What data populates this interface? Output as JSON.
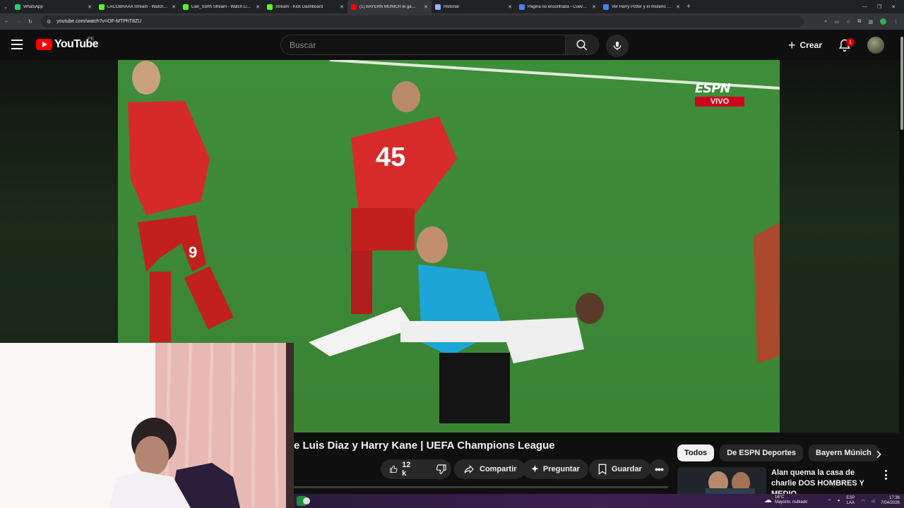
{
  "browser": {
    "tabs": [
      {
        "title": "WhatsApp",
        "color": "#25d366",
        "active": false
      },
      {
        "title": "LACOBRAAA Stream - Watch Li…",
        "color": "#53fc18",
        "active": false
      },
      {
        "title": "Lian_Sorth Stream - Watch Liv…",
        "color": "#53fc18",
        "active": false
      },
      {
        "title": "Stream - Kick Dashboard",
        "color": "#53fc18",
        "active": false
      },
      {
        "title": "(1) BAYERN MUNICH le ga…",
        "color": "#ff0000",
        "active": true
      },
      {
        "title": "Historial",
        "color": "#8ab4f8",
        "active": false
      },
      {
        "title": "Página no encontrada - Cuevan…",
        "color": "#4285f4",
        "active": false
      },
      {
        "title": "Ver Harry Potter y el misterio d…",
        "color": "#4285f4",
        "active": false
      }
    ],
    "url": "youtube.com/watch?v=OF-MTPhT8ZU"
  },
  "youtube": {
    "logo_text": "YouTube",
    "country_code": "PE",
    "search_placeholder": "Buscar",
    "create_label": "Crear",
    "notification_count": "1"
  },
  "player": {
    "broadcaster": "ESPN",
    "live_label": "VIVO"
  },
  "video": {
    "title": "e Luis Diaz y Harry Kane | UEFA Champions League",
    "like_count": "12 k",
    "share_label": "Compartir",
    "ask_label": "Preguntar",
    "save_label": "Guardar"
  },
  "sidebar": {
    "chips": [
      {
        "label": "Todos",
        "active": true
      },
      {
        "label": "De ESPN Deportes",
        "active": false
      },
      {
        "label": "Bayern Múnich",
        "active": false
      }
    ],
    "recommendation": {
      "title": "Alan quema la casa de charlie DOS HOMBRES Y MEDIO ..."
    }
  },
  "taskbar": {
    "weather_temp": "16°C",
    "weather_desc": "Mayorm. nublado",
    "lang": "ESP",
    "lang_sub": "LAA",
    "time": "17:36",
    "date": "7/04/2026"
  },
  "colors": {
    "yt_red": "#ff0000",
    "espn_red": "#d0021b",
    "background": "#0f0f0f"
  }
}
